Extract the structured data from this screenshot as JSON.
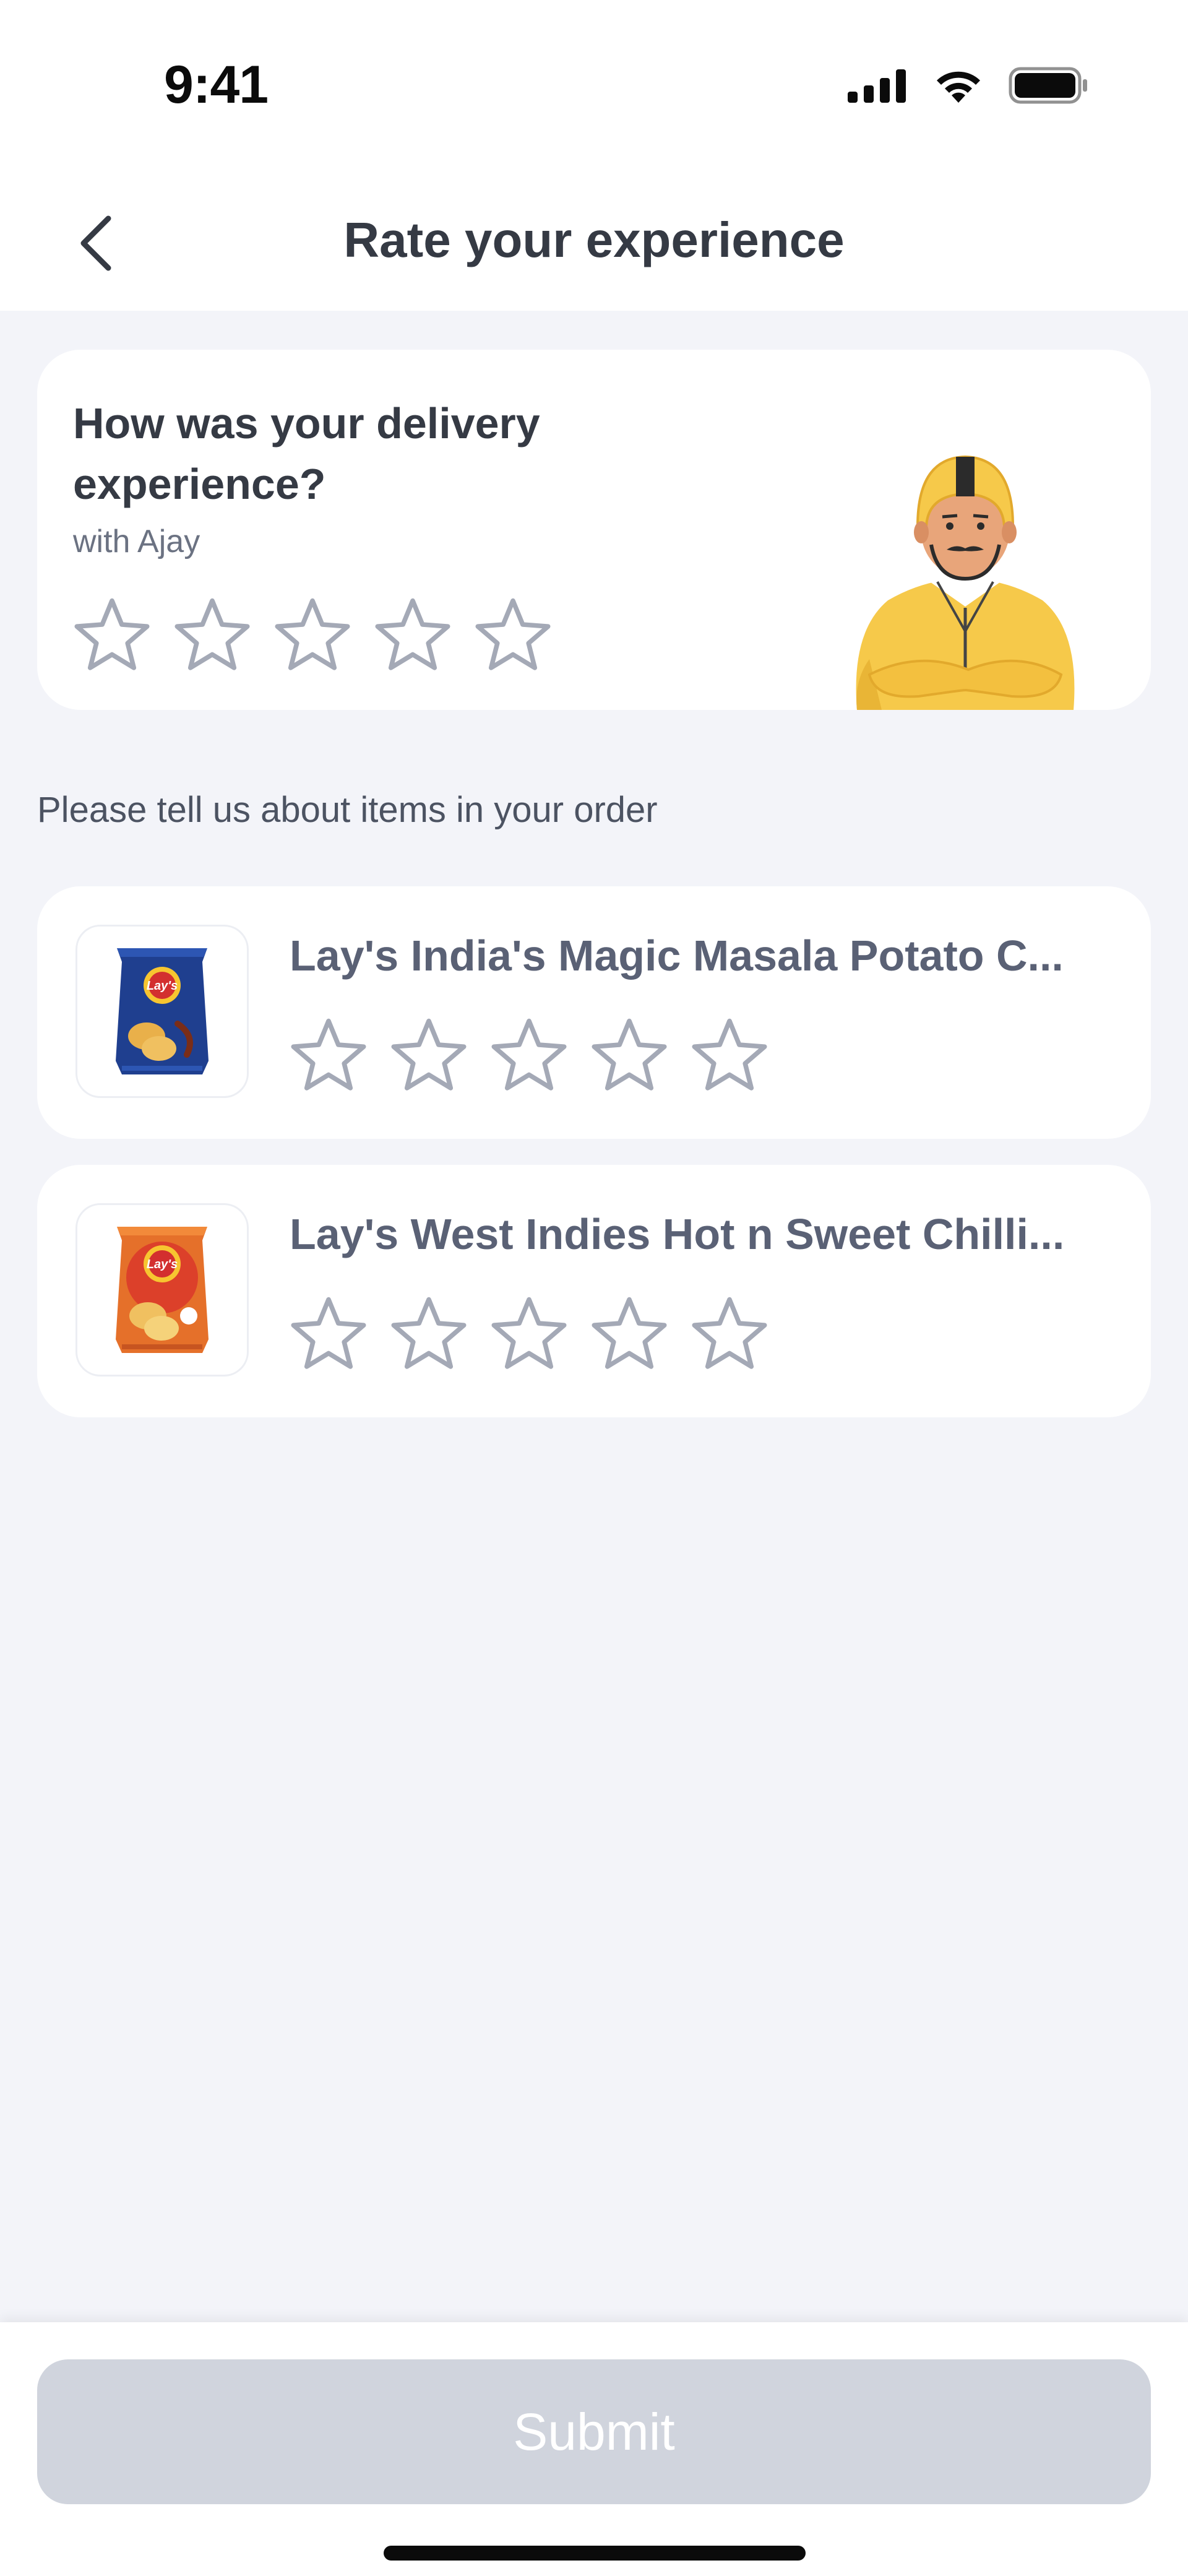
{
  "status_bar": {
    "time": "9:41"
  },
  "header": {
    "title": "Rate your experience"
  },
  "delivery": {
    "question": "How was your delivery experience?",
    "with_text": "with Ajay",
    "rating": 0,
    "max_rating": 5
  },
  "items_section": {
    "label": "Please tell us about items in your order"
  },
  "items": [
    {
      "name": "Lay's India's Magic Masala Potato C...",
      "rating": 0,
      "pack_color": "#1f3f8f"
    },
    {
      "name": "Lay's West Indies Hot n Sweet Chilli...",
      "rating": 0,
      "pack_color": "#e5702a"
    }
  ],
  "submit": {
    "label": "Submit",
    "enabled": false
  },
  "colors": {
    "star_outline": "#a4a9b6",
    "background": "#f3f4f9",
    "submit_disabled": "#d0d4dd",
    "rider_jacket": "#f6c94a"
  }
}
